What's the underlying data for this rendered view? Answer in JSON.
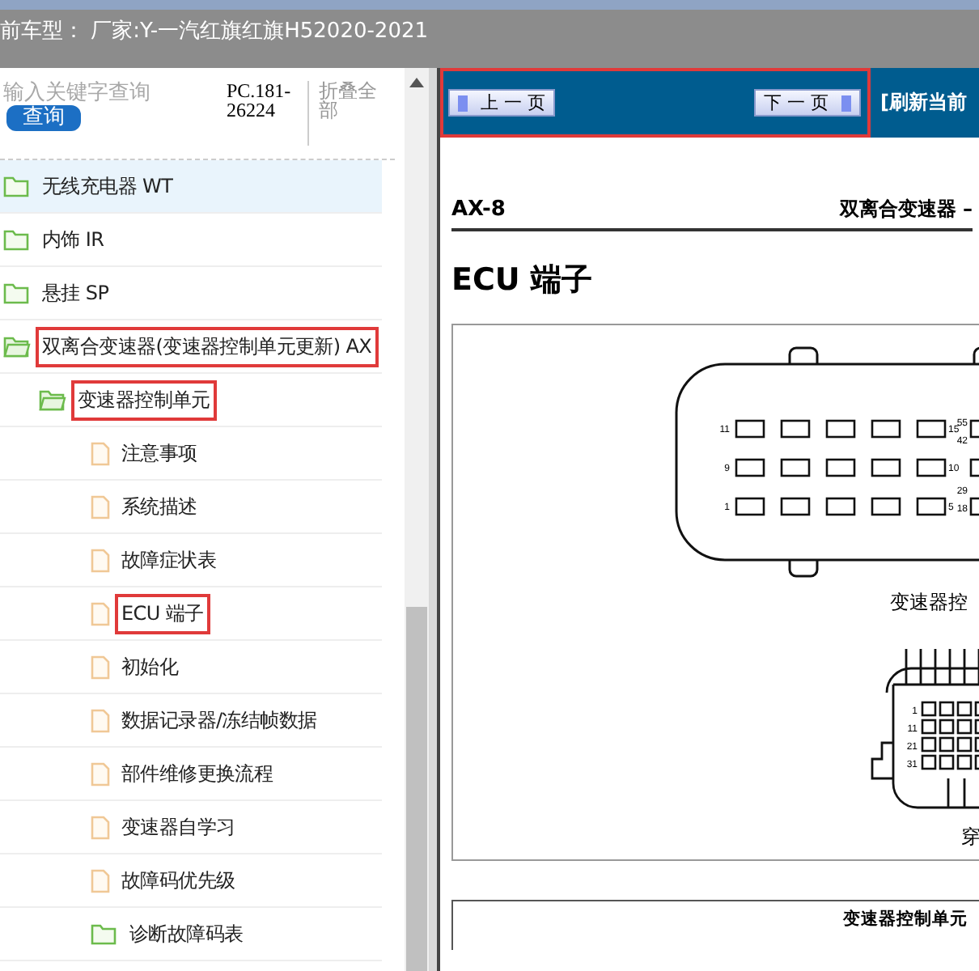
{
  "header": {
    "title": "前车型： 厂家:Y-一汽红旗红旗H52020-2021"
  },
  "sidebar": {
    "search": {
      "placeholder": "输入关键字查询",
      "button": "查询"
    },
    "code": "PC.181-26224",
    "collapse_link": "折叠全部",
    "tree": [
      {
        "label": "无线充电器 WT",
        "kind": "folder",
        "selected": true,
        "highlighted": false,
        "expanded": false
      },
      {
        "label": "内饰 IR",
        "kind": "folder",
        "selected": false,
        "highlighted": false,
        "expanded": false
      },
      {
        "label": "悬挂 SP",
        "kind": "folder",
        "selected": false,
        "highlighted": false,
        "expanded": false
      },
      {
        "label": "双离合变速器(变速器控制单元更新) AX",
        "kind": "folder",
        "selected": false,
        "highlighted": true,
        "expanded": true,
        "children": [
          {
            "label": "变速器控制单元",
            "kind": "folder",
            "selected": false,
            "highlighted": true,
            "expanded": true,
            "children": [
              {
                "label": "注意事项",
                "kind": "page",
                "selected": false,
                "highlighted": false
              },
              {
                "label": "系统描述",
                "kind": "page",
                "selected": false,
                "highlighted": false
              },
              {
                "label": "故障症状表",
                "kind": "page",
                "selected": false,
                "highlighted": false
              },
              {
                "label": "ECU 端子",
                "kind": "page",
                "selected": false,
                "highlighted": true
              },
              {
                "label": "初始化",
                "kind": "page",
                "selected": false,
                "highlighted": false
              },
              {
                "label": "数据记录器/冻结帧数据",
                "kind": "page",
                "selected": false,
                "highlighted": false
              },
              {
                "label": "部件维修更换流程",
                "kind": "page",
                "selected": false,
                "highlighted": false
              },
              {
                "label": "变速器自学习",
                "kind": "page",
                "selected": false,
                "highlighted": false
              },
              {
                "label": "故障码优先级",
                "kind": "page",
                "selected": false,
                "highlighted": false
              },
              {
                "label": "诊断故障码表",
                "kind": "folder",
                "selected": false,
                "highlighted": false,
                "expanded": false
              }
            ]
          }
        ]
      }
    ]
  },
  "viewer": {
    "nav": {
      "highlighted": true,
      "prev_button": "上 一 页",
      "next_button": "下 一 页",
      "refresh_link": "[刷新当前"
    },
    "page": {
      "page_number": "AX-8",
      "section": "双离合变速器 –",
      "title": "ECU 端子",
      "connector_a": {
        "pins": [
          "11",
          "15",
          "55",
          "42",
          "9",
          "10",
          "29",
          "1",
          "5",
          "18"
        ],
        "caption": "变速器控"
      },
      "connector_b": {
        "pins": [
          "1",
          "11",
          "21",
          "31"
        ],
        "caption": "穿"
      },
      "table_header": "变速器控制单元"
    }
  }
}
